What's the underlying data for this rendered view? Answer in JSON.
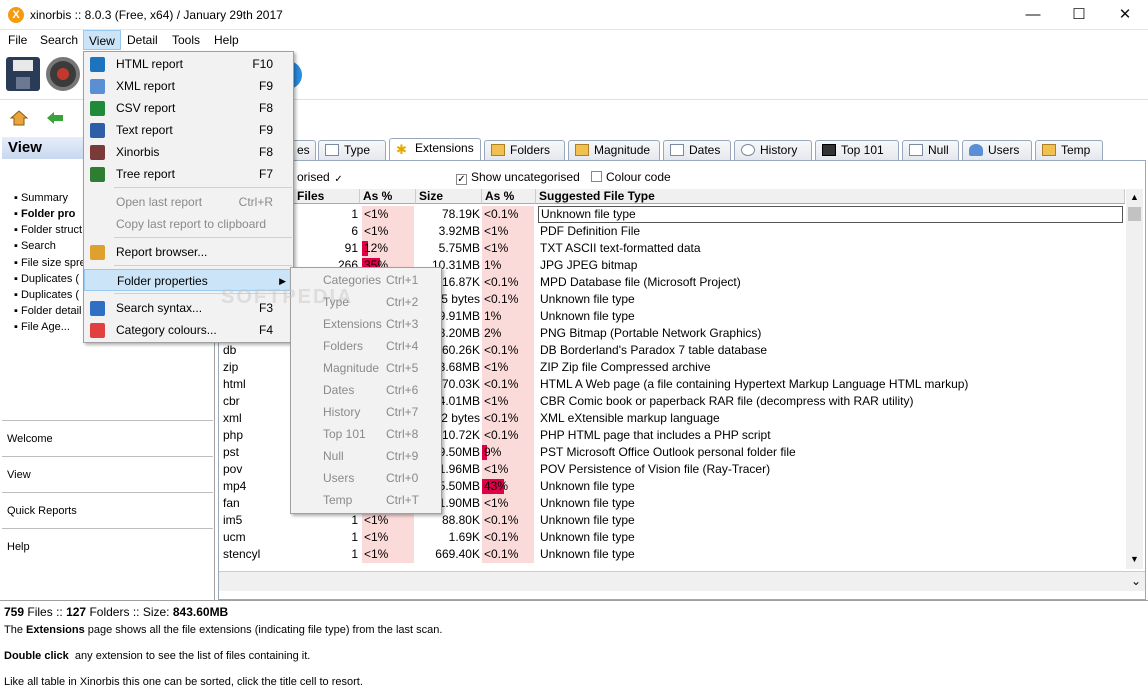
{
  "window": {
    "title": "xinorbis :: 8.0.3 (Free, x64) / January 29th 2017",
    "minimize": "—",
    "maximize": "☐",
    "close": "✕"
  },
  "menubar": [
    "File",
    "Search",
    "View",
    "Detail",
    "Tools",
    "Help"
  ],
  "left": {
    "header": "View",
    "items": [
      "Summary",
      "Folder pro",
      "Folder struct",
      "Search",
      "File size spre",
      "Duplicates (",
      "Duplicates (",
      "Folder detail",
      "File Age..."
    ],
    "nav": [
      "Welcome",
      "View",
      "Quick Reports",
      "Help"
    ]
  },
  "tabs": [
    "es",
    "Type",
    "Extensions",
    "Folders",
    "Magnitude",
    "Dates",
    "History",
    "Top 101",
    "Null",
    "Users",
    "Temp"
  ],
  "options": {
    "uncategorised_label": "orised",
    "show_uncategorised": "Show uncategorised",
    "colour_code": "Colour code",
    "check": "✓"
  },
  "grid": {
    "headers": [
      "Files",
      "As %",
      "Size",
      "As %",
      "Suggested File Type"
    ],
    "rows": [
      {
        "ext": "",
        "files": "1",
        "pct": "<1%",
        "size": "78.19K",
        "spct": "<0.1%",
        "type": "Unknown file type",
        "fbar": 0,
        "sbar": 0
      },
      {
        "ext": "",
        "files": "6",
        "pct": "<1%",
        "size": "3.92MB",
        "spct": "<1%",
        "type": "PDF Definition File",
        "fbar": 0,
        "sbar": 0
      },
      {
        "ext": "",
        "files": "91",
        "pct": "12%",
        "size": "5.75MB",
        "spct": "<1%",
        "type": "TXT ASCII text-formatted data",
        "fbar": 12,
        "sbar": 0
      },
      {
        "ext": "",
        "files": "266",
        "pct": "35%",
        "size": "10.31MB",
        "spct": "1%",
        "type": "JPG JPEG bitmap",
        "fbar": 35,
        "sbar": 0
      },
      {
        "ext": "",
        "files": "",
        "pct": "",
        "size": "16.87K",
        "spct": "<0.1%",
        "type": "MPD Database file (Microsoft Project)",
        "fbar": 0,
        "sbar": 0
      },
      {
        "ext": "",
        "files": "",
        "pct": "",
        "size": "5 bytes",
        "spct": "<0.1%",
        "type": "Unknown file type",
        "fbar": 0,
        "sbar": 0
      },
      {
        "ext": "",
        "files": "",
        "pct": "",
        "size": "9.91MB",
        "spct": "1%",
        "type": "Unknown file type",
        "fbar": 0,
        "sbar": 0
      },
      {
        "ext": "",
        "files": "",
        "pct": "",
        "size": "8.20MB",
        "spct": "2%",
        "type": "PNG Bitmap (Portable Network Graphics)",
        "fbar": 0,
        "sbar": 0
      },
      {
        "ext": "db",
        "files": "",
        "pct": "",
        "size": "60.26K",
        "spct": "<0.1%",
        "type": "DB Borderland's Paradox 7 table database",
        "fbar": 0,
        "sbar": 0
      },
      {
        "ext": "zip",
        "files": "",
        "pct": "",
        "size": "3.68MB",
        "spct": "<1%",
        "type": "ZIP Zip file Compressed archive",
        "fbar": 0,
        "sbar": 0
      },
      {
        "ext": "html",
        "files": "",
        "pct": "",
        "size": "270.03K",
        "spct": "<0.1%",
        "type": "HTML A Web page (a file containing Hypertext Markup Language HTML markup)",
        "fbar": 0,
        "sbar": 0
      },
      {
        "ext": "cbr",
        "files": "",
        "pct": "",
        "size": "4.01MB",
        "spct": "<1%",
        "type": "CBR Comic book or paperback RAR file (decompress with RAR utility)",
        "fbar": 0,
        "sbar": 0
      },
      {
        "ext": "xml",
        "files": "",
        "pct": "",
        "size": "2 bytes",
        "spct": "<0.1%",
        "type": "XML eXtensible markup language",
        "fbar": 0,
        "sbar": 0
      },
      {
        "ext": "php",
        "files": "",
        "pct": "",
        "size": "10.72K",
        "spct": "<0.1%",
        "type": "PHP HTML page that includes a PHP script",
        "fbar": 0,
        "sbar": 0
      },
      {
        "ext": "pst",
        "files": "",
        "pct": "",
        "size": "9.50MB",
        "spct": "9%",
        "type": "PST Microsoft Office Outlook personal folder file",
        "fbar": 0,
        "sbar": 9
      },
      {
        "ext": "pov",
        "files": "",
        "pct": "",
        "size": "1.96MB",
        "spct": "<1%",
        "type": "POV Persistence of Vision file (Ray-Tracer)",
        "fbar": 0,
        "sbar": 0
      },
      {
        "ext": "mp4",
        "files": "",
        "pct": "",
        "size": "5.50MB",
        "spct": "43%",
        "type": "Unknown file type",
        "fbar": 0,
        "sbar": 43
      },
      {
        "ext": "fan",
        "files": "",
        "pct": "",
        "size": "1.90MB",
        "spct": "<1%",
        "type": "Unknown file type",
        "fbar": 0,
        "sbar": 0
      },
      {
        "ext": "im5",
        "files": "1",
        "pct": "<1%",
        "size": "88.80K",
        "spct": "<0.1%",
        "type": "Unknown file type",
        "fbar": 0,
        "sbar": 0
      },
      {
        "ext": "ucm",
        "files": "1",
        "pct": "<1%",
        "size": "1.69K",
        "spct": "<0.1%",
        "type": "Unknown file type",
        "fbar": 0,
        "sbar": 0
      },
      {
        "ext": "stencyl",
        "files": "1",
        "pct": "<1%",
        "size": "669.40K",
        "spct": "<0.1%",
        "type": "Unknown file type",
        "fbar": 0,
        "sbar": 0
      }
    ]
  },
  "view_menu": [
    {
      "label": "HTML report",
      "shortcut": "F10",
      "icon": "html-icon",
      "color": "#1e73be"
    },
    {
      "label": "XML report",
      "shortcut": "F9",
      "icon": "xml-icon",
      "color": "#5a8fd6"
    },
    {
      "label": "CSV report",
      "shortcut": "F8",
      "icon": "csv-icon",
      "color": "#1e8a3a"
    },
    {
      "label": "Text report",
      "shortcut": "F9",
      "icon": "text-icon",
      "color": "#2f5ea8"
    },
    {
      "label": "Xinorbis",
      "shortcut": "F8",
      "icon": "xinorbis-icon",
      "color": "#7a3a3a"
    },
    {
      "label": "Tree report",
      "shortcut": "F7",
      "icon": "tree-icon",
      "color": "#2e7d32"
    },
    {
      "label": "Open last report",
      "shortcut": "Ctrl+R",
      "disabled": true
    },
    {
      "label": "Copy last report to clipboard",
      "shortcut": "",
      "disabled": true
    },
    {
      "label": "Report browser...",
      "shortcut": "",
      "icon": "folder-icon",
      "color": "#e0a030"
    },
    {
      "label": "Folder properties",
      "shortcut": "",
      "highlight": true
    },
    {
      "label": "Search syntax...",
      "shortcut": "F3",
      "icon": "book-icon",
      "color": "#2f6fc4"
    },
    {
      "label": "Category colours...",
      "shortcut": "F4",
      "icon": "palette-icon",
      "color": "#e04040"
    }
  ],
  "submenu": [
    {
      "label": "Categories",
      "shortcut": "Ctrl+1"
    },
    {
      "label": "Type",
      "shortcut": "Ctrl+2"
    },
    {
      "label": "Extensions",
      "shortcut": "Ctrl+3"
    },
    {
      "label": "Folders",
      "shortcut": "Ctrl+4"
    },
    {
      "label": "Magnitude",
      "shortcut": "Ctrl+5"
    },
    {
      "label": "Dates",
      "shortcut": "Ctrl+6"
    },
    {
      "label": "History",
      "shortcut": "Ctrl+7"
    },
    {
      "label": "Top 101",
      "shortcut": "Ctrl+8"
    },
    {
      "label": "Null",
      "shortcut": "Ctrl+9"
    },
    {
      "label": "Users",
      "shortcut": "Ctrl+0"
    },
    {
      "label": "Temp",
      "shortcut": "Ctrl+T"
    }
  ],
  "status": {
    "files_count": "759",
    "files_label": "Files",
    "sep": "::",
    "folders_count": "127",
    "folders_label": "Folders",
    "size_label": "Size:",
    "size_value": "843.60MB",
    "line1_pre": "The",
    "line1_bold": "Extensions",
    "line1_post": "page shows all the file extensions (indicating file type) from the last scan.",
    "line2_bold": "Double click",
    "line2_post": "any extension to see the list of files containing it.",
    "line3": "Like all table in Xinorbis this one can be sorted, click the title cell to resort."
  },
  "watermark": "SOFTPEDIA"
}
